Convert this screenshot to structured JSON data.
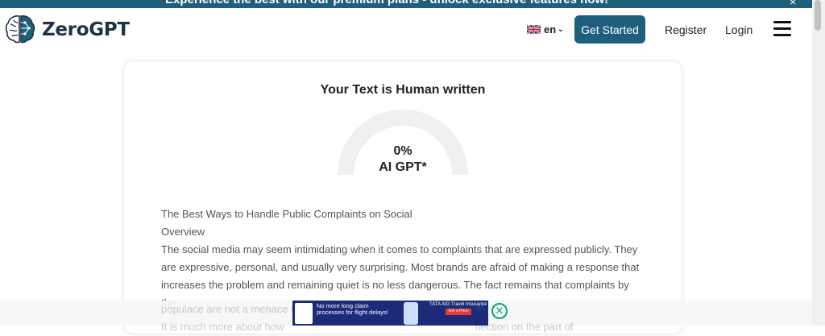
{
  "promo": {
    "text": "Experience the best with our premium plans - unlock exclusive features now!",
    "close": "×"
  },
  "nav": {
    "logo_text": "ZeroGPT",
    "lang": "en",
    "get_started": "Get Started",
    "register": "Register",
    "login": "Login"
  },
  "result": {
    "title": "Your Text is Human written",
    "percent": "0%",
    "label": "AI GPT*",
    "ai_fraction": 0
  },
  "text_lines": [
    "The Best Ways to Handle Public Complaints on Social",
    "Overview",
    "The social media may seem intimidating when it comes to complaints that are expressed publicly. They are expressive, personal, and usually very surprising. Most brands are afraid of making a response that increases the problem and remaining quiet is no less dangerous. The fact remains that complaints by the"
  ],
  "overlap_text": [
    "populace are not a menace t",
    "It is much more about how",
    "flection on the part of"
  ],
  "ad": {
    "headline": "No more long claim processes for flight delays!",
    "sub": "Get instant compensation with Smart Travel Insurance",
    "brand": "TATA AIG Travel Insurance",
    "cta": "Get a Price",
    "info": "ⓘ",
    "close": "✕"
  },
  "colors": {
    "primary": "#1f5f7e",
    "logo_text": "#1f3147",
    "gauge_track": "#f0f0f0"
  }
}
